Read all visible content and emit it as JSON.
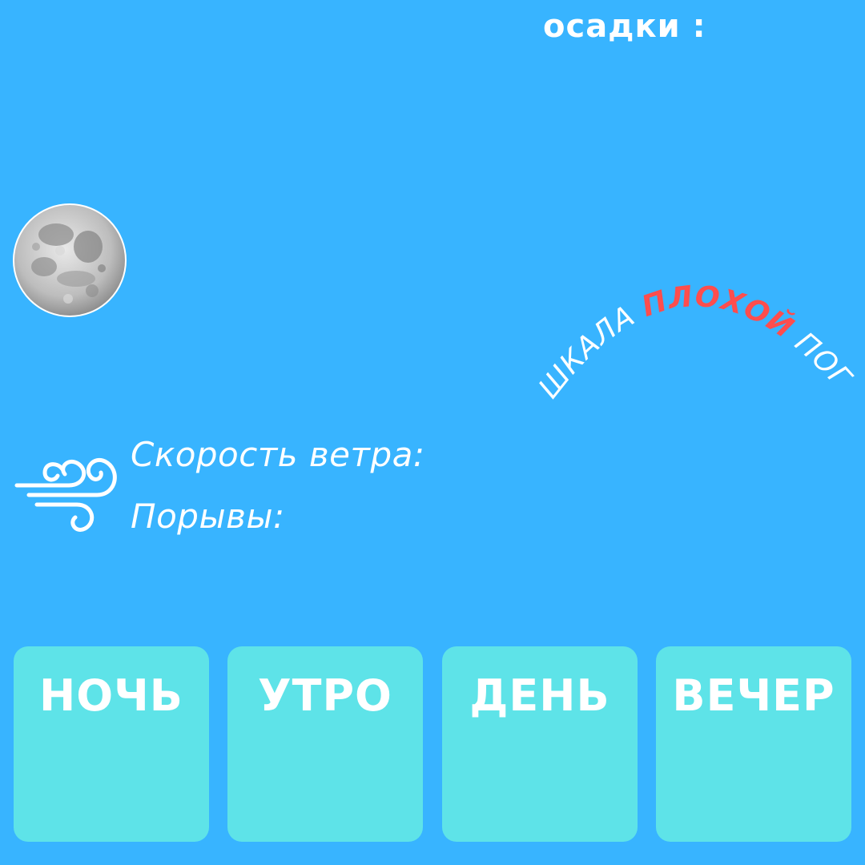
{
  "header": {
    "precipitation_label": "осадки :"
  },
  "scale": {
    "part1": "ШКАЛА ",
    "part2": "ПЛОХОЙ",
    "part3": " ПОГОДЫ",
    "highlight_color": "#ff4d4d"
  },
  "wind": {
    "speed_label": "Скорость ветра:",
    "gusts_label": "Порывы:"
  },
  "periods": [
    {
      "label": "НОЧЬ"
    },
    {
      "label": "УТРО"
    },
    {
      "label": "ДЕНЬ"
    },
    {
      "label": "ВЕЧЕР"
    }
  ],
  "colors": {
    "background": "#38b4ff",
    "card": "#5ee3e8",
    "text": "#ffffff"
  },
  "icons": {
    "moon": "moon-icon",
    "wind": "wind-icon"
  }
}
